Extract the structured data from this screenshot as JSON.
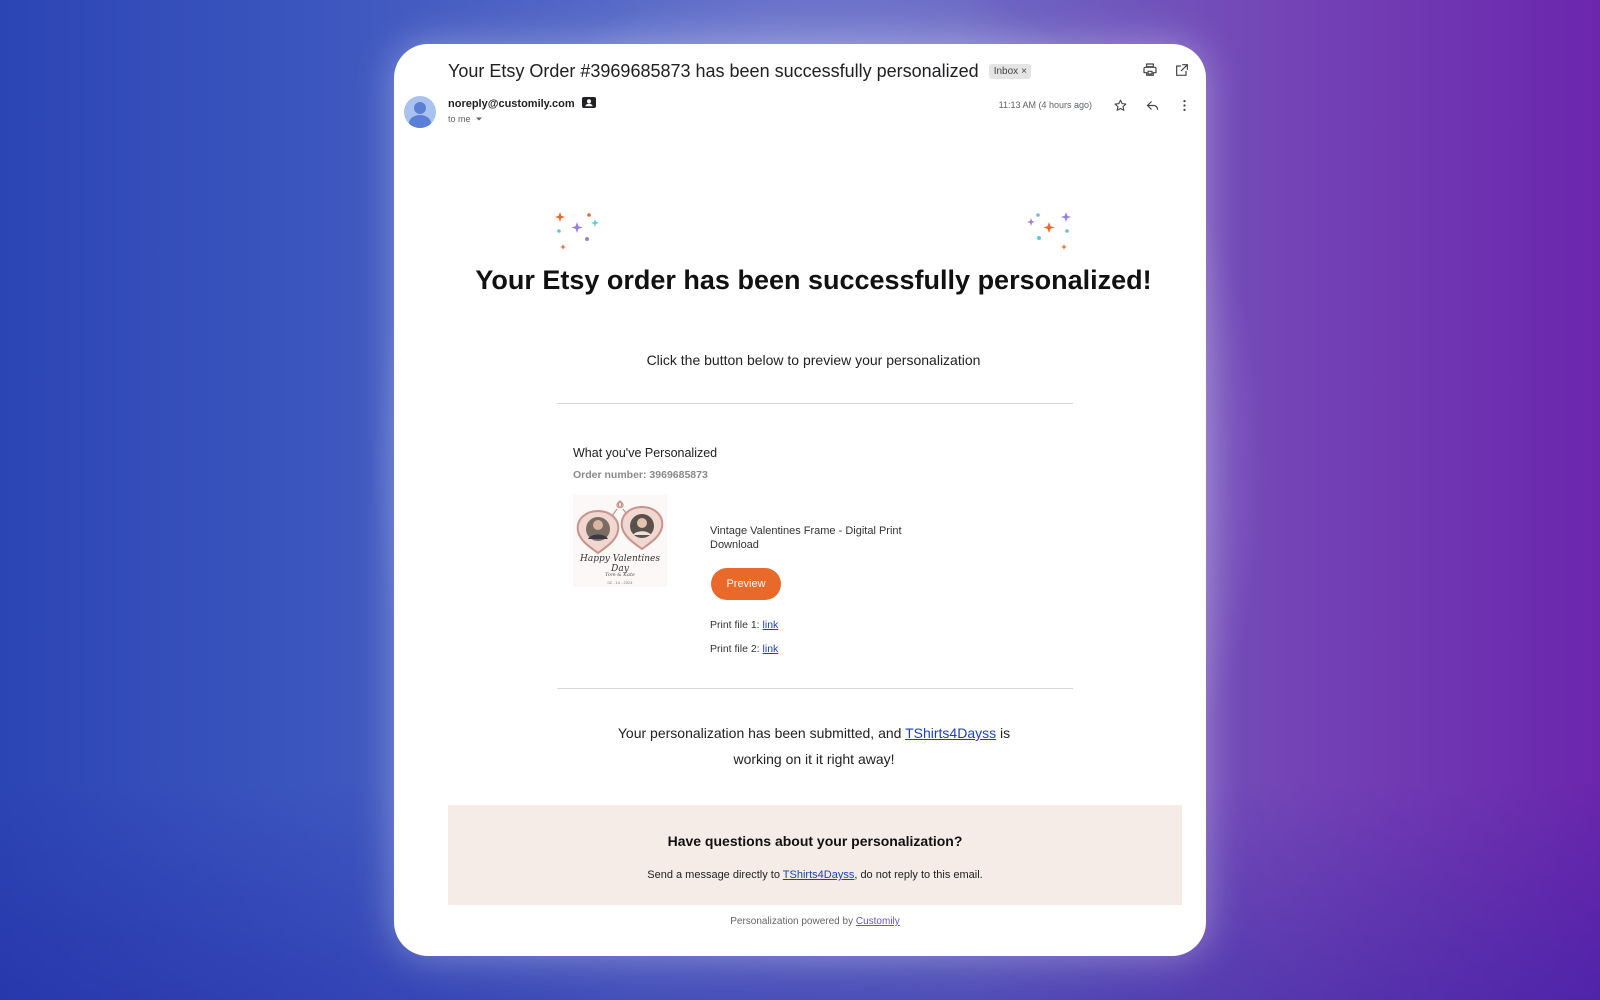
{
  "email": {
    "subject": "Your Etsy Order #3969685873 has been successfully personalized",
    "label_badge": "Inbox",
    "label_remove": "×",
    "sender": "noreply@customily.com",
    "recipient": "to me",
    "time": "11:13 AM (4 hours ago)",
    "icons": [
      "print-icon",
      "open-in-new-icon",
      "contact-card-icon",
      "star-icon",
      "reply-icon",
      "more-vert-icon",
      "chevron-down-icon",
      "avatar"
    ]
  },
  "body": {
    "headline": "Your Etsy order has been successfully personalized!",
    "subline": "Click the button below to preview your personalization",
    "section_title": "What you've Personalized",
    "order_number": "Order number: 3969685873",
    "product": {
      "name": "Vintage Valentines Frame - Digital Print Download",
      "image_text": "Happy Valentines Day",
      "image_names": "Tom & Kate",
      "image_date": "02 - 14 - 2024"
    },
    "preview_label": "Preview",
    "print_files": [
      {
        "label": "Print file 1:",
        "link": "link"
      },
      {
        "label": "Print file 2:",
        "link": "link"
      }
    ],
    "submitted_before": "Your personalization has been submitted, and ",
    "submitted_shop": "TShirts4Dayss",
    "submitted_after": " is working on it it right away!"
  },
  "questions": {
    "title": "Have questions about your personalization?",
    "text_before": "Send a message directly to ",
    "shop_link": "TShirts4Dayss",
    "text_after": ", do not reply to this email."
  },
  "footer": {
    "text": "Personalization powered by ",
    "link": "Customily"
  },
  "colors": {
    "accent": "#e8692a",
    "link": "#1a3fbf",
    "footer_link": "#6a52c4",
    "questions_bg": "#f5ebe7"
  }
}
